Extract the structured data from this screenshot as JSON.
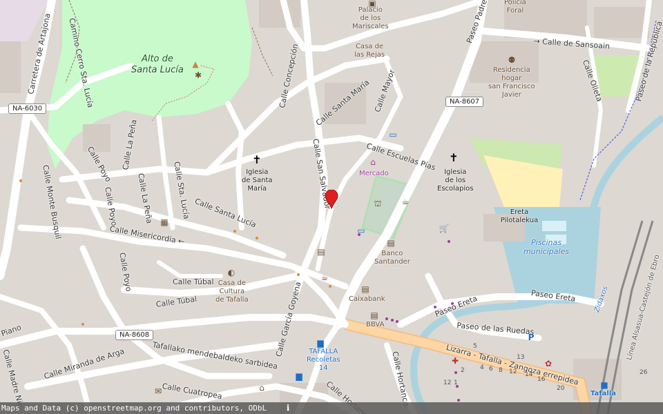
{
  "map": {
    "attribution": "Maps and Data (c) openstreetmap.org and contributors, ODbL",
    "area_labels": {
      "hill": [
        "Alto de",
        "Santa Lucía"
      ],
      "pool": "Piscinas municipales",
      "ereta": "Ereta Pilotalekua"
    },
    "streets": {
      "artajona": "Carretera de Artajona",
      "cerro_sta": "Camino Cerro Sta. Lucía",
      "camino_cerro": "Camino Cerro Sta. Lucía",
      "concepcion": "Calle Concepción",
      "santa_maria": "Calle Santa María",
      "mayor": "Calle Mayor",
      "san_salvador": "Calle San Salvador",
      "escuelas_pias": "Calle Escuelas Pías",
      "padre": "Paseo Padre",
      "sansoain": "Calle de Sansoain",
      "olleta": "Calle Olleta",
      "republica": "Paseo de la República",
      "la_pena1": "Calle La Peña",
      "la_pena2": "Calle La Peña",
      "poyo1": "Calle Poyo",
      "poyo2": "Calle Poyo",
      "poyo3": "Calle Poyo",
      "sta_lucia1": "Calle Sta. Lucía",
      "santa_lucia": "Calle Santa Lucía",
      "monte_busquil": "Calle Monte Busquil",
      "misericordia": "Calle Misericordia",
      "tubal1": "Calle Túbal",
      "tubal2": "Calle Túbal",
      "garcia_goyena": "Calle García Goyena",
      "ereta1": "Paseo Ereta",
      "ereta2": "Paseo Ereta",
      "ruedas": "Paseo de las Ruedas",
      "lizarra": "Lizarra - Tafalla - Zangoza errepidea",
      "hortanco1": "Calle Hortanco",
      "hortanco2": "Calle Hortanco",
      "piano": "Piano",
      "miranda": "Calle Miranda de Arga",
      "tafallako": "Tafallako mendebaldeko sarbidea",
      "madre": "Calle Madre Nic",
      "cuatropea": "Calle Cuatropea",
      "zidaxos": "Zidaxos",
      "alsasua": "Línea Alsasua-Castejón de Ebro"
    },
    "shields": {
      "na6030": "NA-6030",
      "na8607": "NA-8607",
      "na8608": "NA-8608"
    },
    "pois": {
      "palacio": [
        "Palacio",
        "de los",
        "Mariscales"
      ],
      "casa_rejas": [
        "Casa de",
        "las Rejas"
      ],
      "policia": [
        "Policía",
        "Foral"
      ],
      "residencia": [
        "Residencia",
        "hogar",
        "san Francisco",
        "Javier"
      ],
      "iglesia_sm": [
        "Iglesia",
        "de Santa",
        "María"
      ],
      "mercado": "Mercado",
      "iglesia_esc": [
        "Iglesia",
        "de los",
        "Escolapios"
      ],
      "banco": [
        "Banco",
        "Santander"
      ],
      "caixabank": "Caixabank",
      "bbva": "BBVA",
      "cultura": [
        "Casa de",
        "Cultura",
        "de Tafalla"
      ],
      "bus": [
        "TAFALLA",
        "Recoletas",
        "14"
      ],
      "tafalla_station": "Tafalla"
    },
    "house_numbers": [
      "5",
      "13",
      "4",
      "6",
      "8",
      "12",
      "2",
      "14",
      "16",
      "12",
      "1",
      "20",
      "26"
    ],
    "colors": {
      "background": "#ddd8d2",
      "park": "#c8facc",
      "water": "#aad3df",
      "road_major": "#fcd6a4",
      "road_minor": "#ffffff",
      "building": "#d9d0c9",
      "pin": "#e02020"
    },
    "icons": {
      "pin": "location-pin",
      "church1": "church-cross",
      "church2": "church-cross"
    }
  }
}
